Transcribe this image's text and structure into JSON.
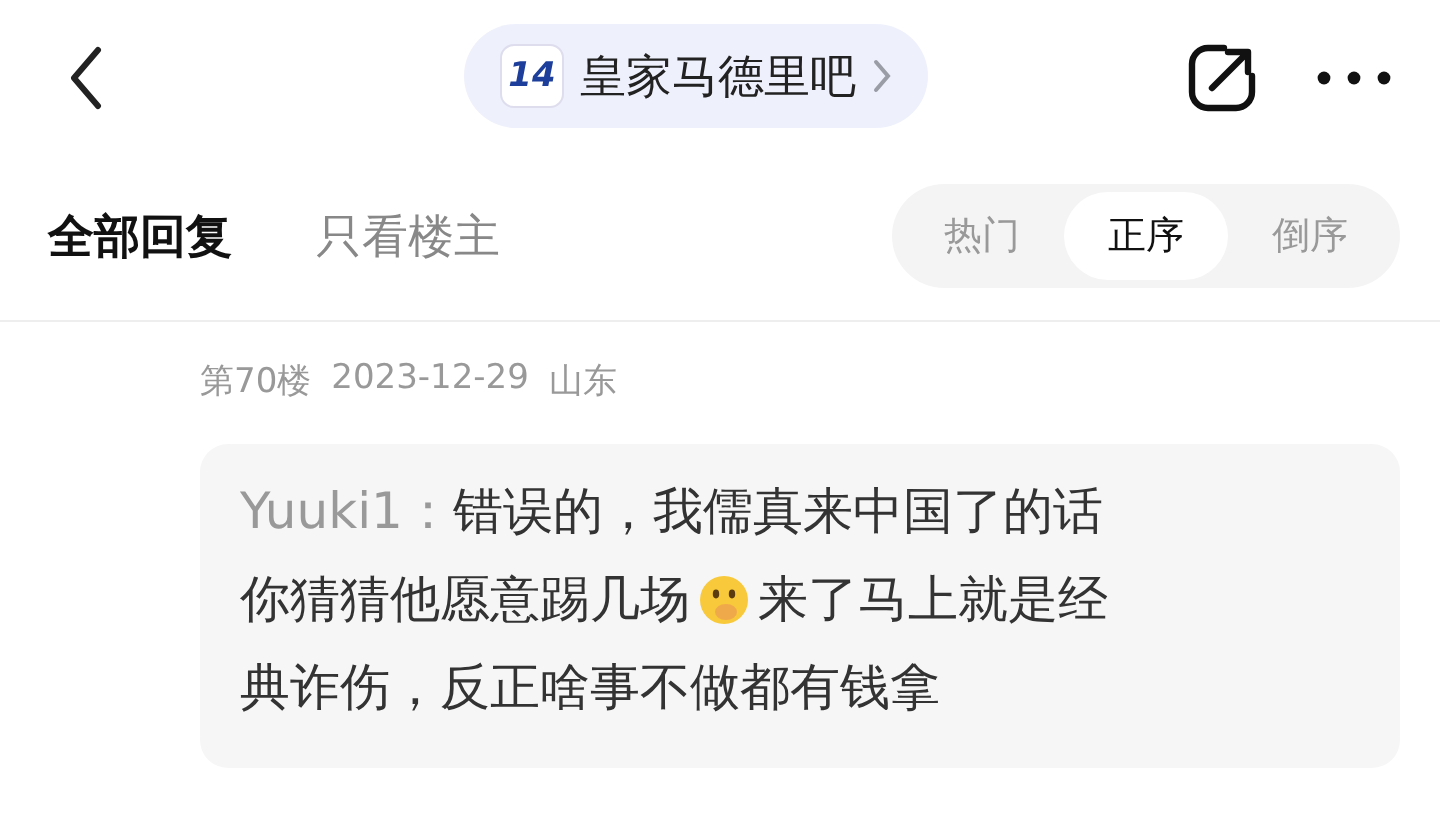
{
  "forum": {
    "logo_text": "14",
    "name": "皇家马德里吧"
  },
  "filter_tabs": [
    {
      "label": "全部回复",
      "selected": true
    },
    {
      "label": "只看楼主",
      "selected": false
    }
  ],
  "sort_options": [
    {
      "label": "热门",
      "selected": false
    },
    {
      "label": "正序",
      "selected": true
    },
    {
      "label": "倒序",
      "selected": false
    }
  ],
  "reply": {
    "floor": "第70楼",
    "date": "2023-12-29",
    "location": "山东",
    "lines": [
      [
        {
          "kind": "author",
          "text": "Yuuki1："
        },
        {
          "kind": "text",
          "text": "错误的，我儒真来中国了的话"
        }
      ],
      [
        {
          "kind": "text",
          "text": "你猜猜他愿意踢几场"
        },
        {
          "kind": "emoji"
        },
        {
          "kind": "text",
          "text": "来了马上就是经"
        }
      ],
      [
        {
          "kind": "text",
          "text": "典诈伤，反正啥事不做都有钱拿"
        }
      ]
    ]
  }
}
